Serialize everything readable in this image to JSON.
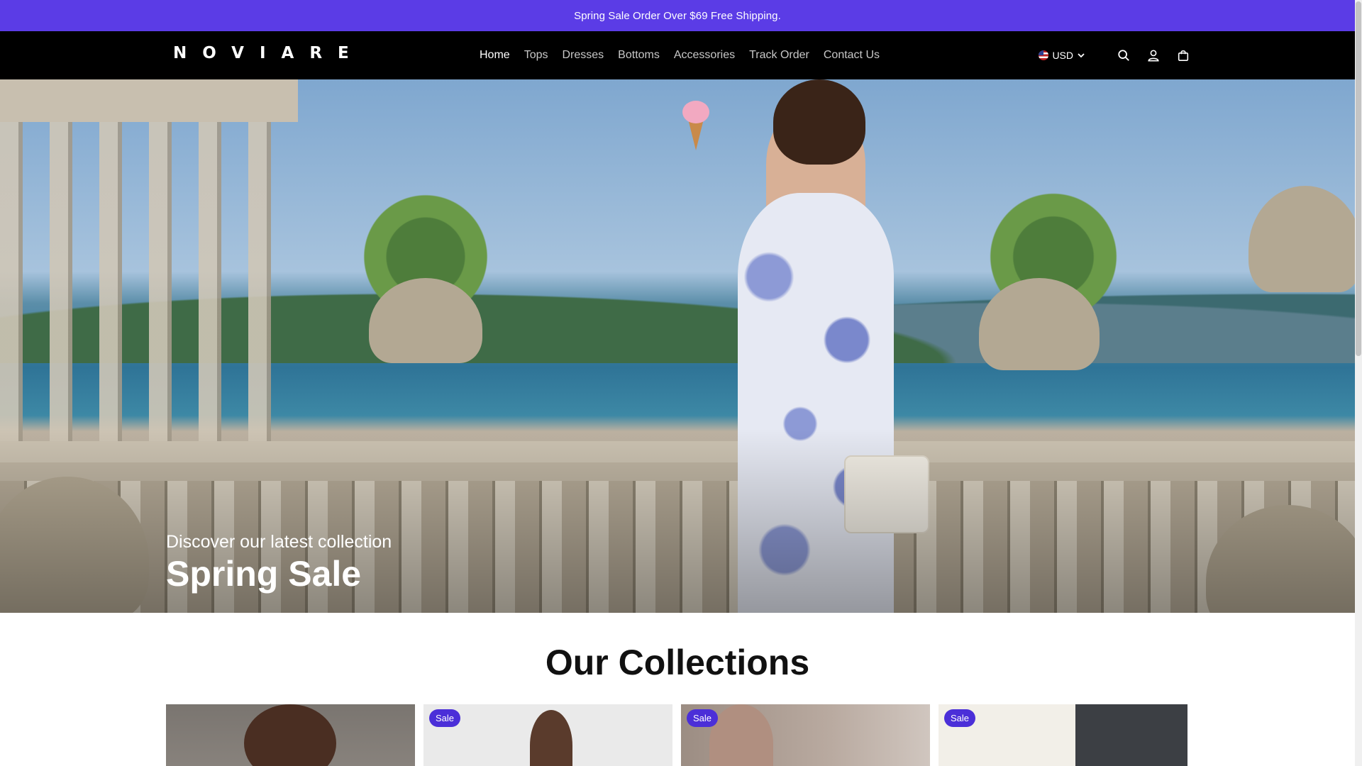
{
  "announcement": {
    "text": "Spring Sale Order Over $69 Free Shipping."
  },
  "header": {
    "logo": "NOVIARE",
    "nav": [
      {
        "label": "Home",
        "active": true
      },
      {
        "label": "Tops",
        "active": false
      },
      {
        "label": "Dresses",
        "active": false
      },
      {
        "label": "Bottoms",
        "active": false
      },
      {
        "label": "Accessories",
        "active": false
      },
      {
        "label": "Track Order",
        "active": false
      },
      {
        "label": "Contact Us",
        "active": false
      }
    ],
    "currency": "USD",
    "icons": [
      "search-icon",
      "account-icon",
      "cart-icon",
      "chevron-down-icon",
      "us-flag-icon"
    ]
  },
  "hero": {
    "subtitle": "Discover our latest collection",
    "title": "Spring Sale"
  },
  "collections": {
    "title": "Our Collections",
    "cards": [
      {
        "badge": ""
      },
      {
        "badge": "Sale"
      },
      {
        "badge": "Sale"
      },
      {
        "badge": "Sale"
      }
    ]
  },
  "colors": {
    "announcement_bg": "#5b3ce6",
    "header_bg": "#000000",
    "badge_bg": "#4b2fd8"
  }
}
